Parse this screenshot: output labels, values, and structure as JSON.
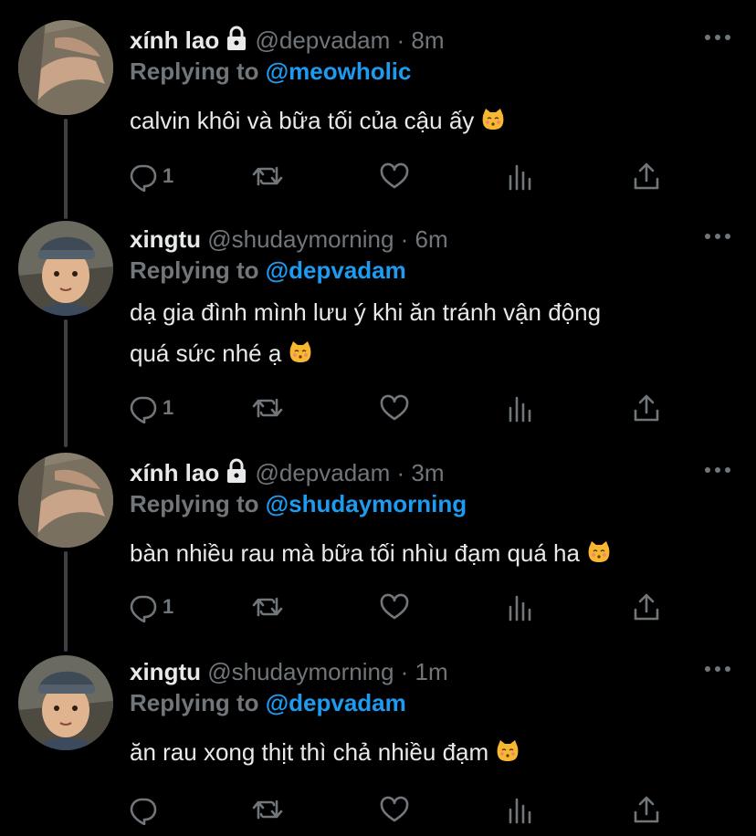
{
  "tweets": [
    {
      "name": "xính lao",
      "locked": true,
      "handle": "@depvadam",
      "time": "8m",
      "replying_prefix": "Replying to ",
      "replying_to": "@meowholic",
      "text": "calvin khôi và bữa tối của cậu ấy",
      "reply_count": "1"
    },
    {
      "name": "xingtu",
      "locked": false,
      "handle": "@shudaymorning",
      "time": "6m",
      "replying_prefix": "Replying to ",
      "replying_to": "@depvadam",
      "text_line1": "dạ gia đình mình lưu ý khi ăn tránh vận động",
      "text_line2": "quá sức nhé ạ",
      "reply_count": "1"
    },
    {
      "name": "xính lao",
      "locked": true,
      "handle": "@depvadam",
      "time": "3m",
      "replying_prefix": "Replying to ",
      "replying_to": "@shudaymorning",
      "text": "bàn nhiều rau mà bữa tối nhìu đạm quá ha",
      "reply_count": "1"
    },
    {
      "name": "xingtu",
      "locked": false,
      "handle": "@shudaymorning",
      "time": "1m",
      "replying_prefix": "Replying to ",
      "replying_to": "@depvadam",
      "text": "ăn rau xong thịt thì chả nhiều đạm",
      "reply_count": ""
    }
  ],
  "separator": " · ",
  "icons": {
    "reply": "reply-icon",
    "retweet": "retweet-icon",
    "like": "like-icon",
    "analytics": "analytics-icon",
    "share": "share-icon",
    "more": "more-icon",
    "lock": "lock-icon",
    "emoji": "kissing-cat-emoji"
  },
  "colors": {
    "background": "#000000",
    "text": "#e7e9ea",
    "muted": "#71767b",
    "accent": "#1d9bf0",
    "thread_line": "#3e4144"
  }
}
